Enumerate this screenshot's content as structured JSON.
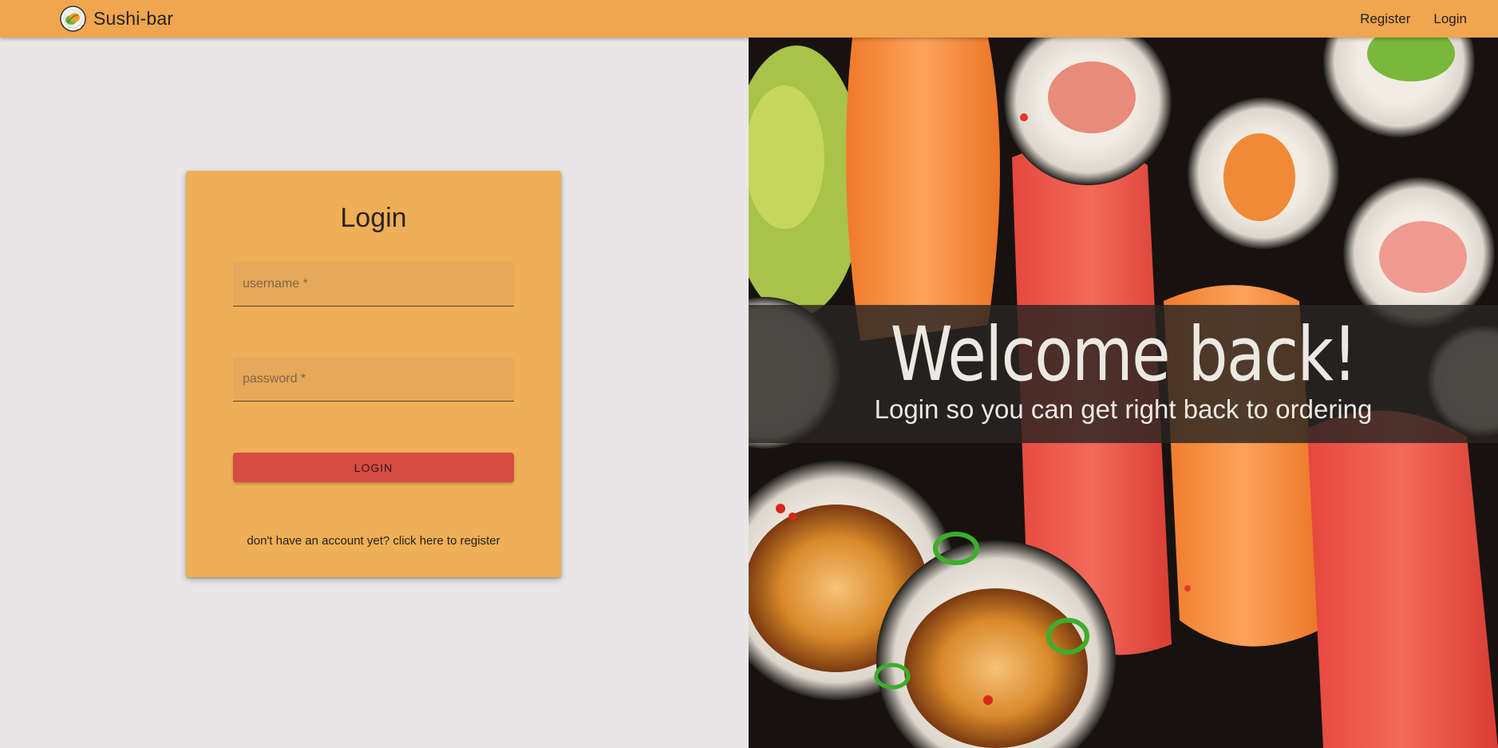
{
  "app": {
    "brand_name": "Sushi-bar",
    "logo_icon": "sushi-roll-logo-icon"
  },
  "nav": {
    "register_label": "Register",
    "login_label": "Login"
  },
  "login_form": {
    "title": "Login",
    "username_placeholder": "username *",
    "password_placeholder": "password *",
    "submit_label": "LOGIN",
    "register_link": "don't have an account yet? click here to register"
  },
  "hero": {
    "title": "Welcome back!",
    "subtitle": "Login so you can get right back to ordering",
    "image": "sushi-photo"
  },
  "colors": {
    "topbar": "#f0a54f",
    "card": "#efaf57",
    "button": "#d64c42",
    "page_background": "#e8e6e6"
  }
}
